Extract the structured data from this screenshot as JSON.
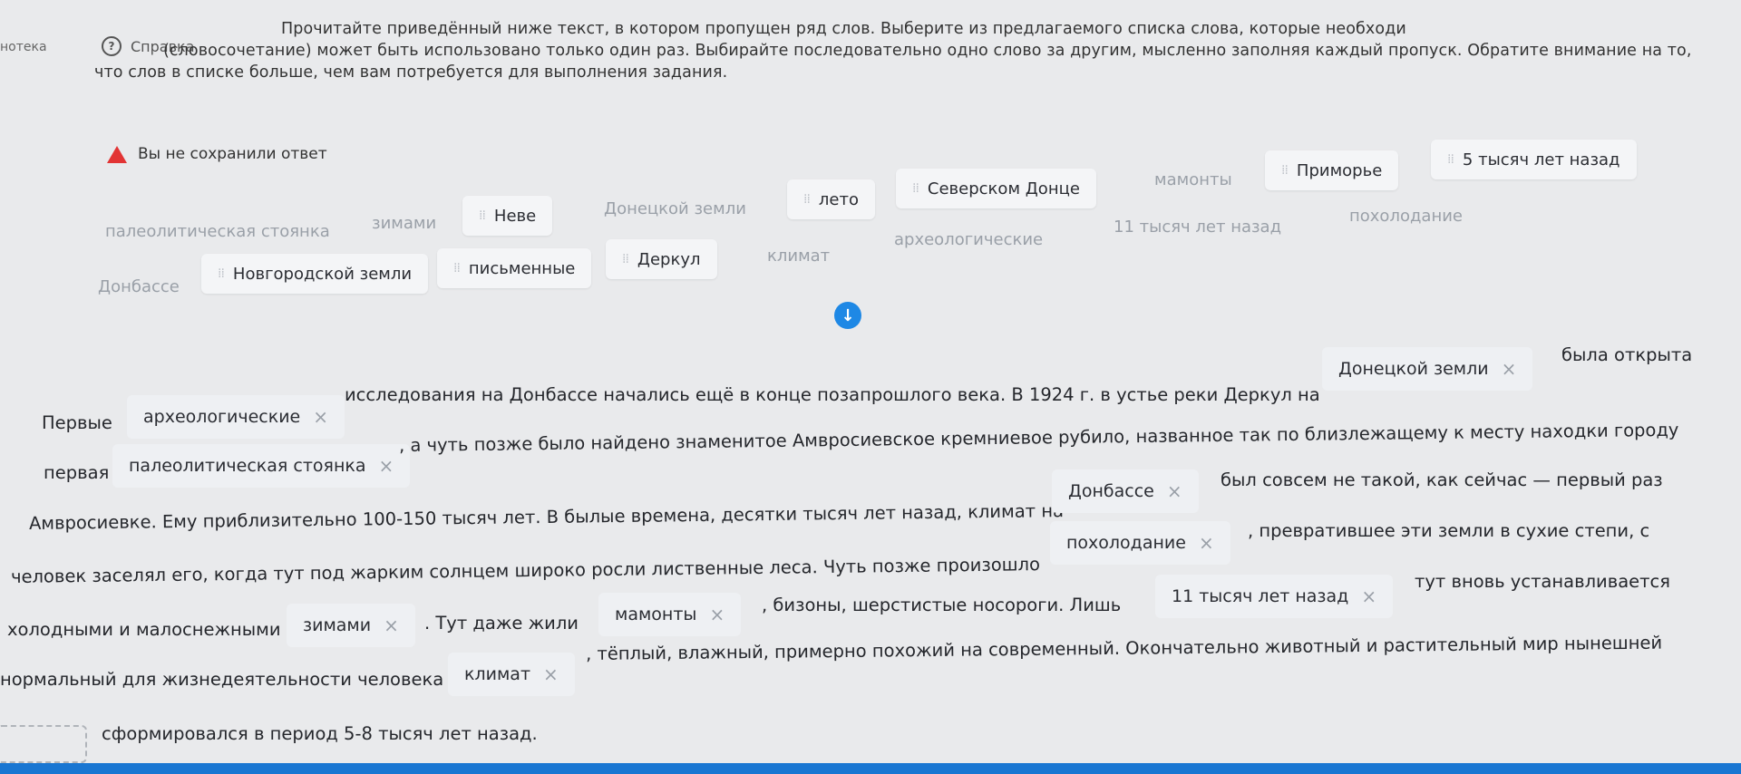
{
  "header": {
    "library_label": "нотека",
    "help_label": "Справка",
    "instruction": "Прочитайте приведённый ниже текст, в котором пропущен ряд слов. Выберите из предлагаемого списка слова, которые необходимо вставить на место пропусков, мысленно заполняя каждый пропуск. Обратите внимание на то, что каждое слово (словосочетание) может быть использовано только один раз. Выбирайте последовательно одно слово за другим, мысленно заполняя каждый пропуск. Обратите внимание на то, что слов в списке больше, чем вам потребуется для выполнения задания.",
    "instruction_lines": [
      "Прочитайте приведённый ниже текст, в котором пропущен ряд слов. Выберите из предлагаемого списка слова, которые необходи",
      "(словосочетание) может быть использовано только один раз. Выбирайте последовательно одно слово за другим, мысленно заполняя каждый пропуск. Обратите внимание на то,",
      "что слов в списке больше, чем вам потребуется для выполнения задания."
    ]
  },
  "warning": {
    "text": "Вы не сохранили ответ"
  },
  "word_bank": [
    {
      "label": "лето",
      "state": "active"
    },
    {
      "label": "Северском Донце",
      "state": "active"
    },
    {
      "label": "мамонты",
      "state": "used"
    },
    {
      "label": "Приморье",
      "state": "active"
    },
    {
      "label": "5 тысяч лет назад",
      "state": "active"
    },
    {
      "label": "палеолитическая стоянка",
      "state": "used"
    },
    {
      "label": "зимами",
      "state": "used"
    },
    {
      "label": "Неве",
      "state": "active"
    },
    {
      "label": "Донецкой земли",
      "state": "used"
    },
    {
      "label": "11 тысяч лет назад",
      "state": "used"
    },
    {
      "label": "похолодание",
      "state": "used"
    },
    {
      "label": "Донбассе",
      "state": "used"
    },
    {
      "label": "Новгородской земли",
      "state": "active"
    },
    {
      "label": "письменные",
      "state": "active"
    },
    {
      "label": "Деркул",
      "state": "active"
    },
    {
      "label": "климат",
      "state": "used"
    },
    {
      "label": "археологические",
      "state": "used"
    }
  ],
  "passage": {
    "segments": [
      "Первые",
      "исследования на Донбассе начались ещё в конце позапрошлого века. В 1924 г. в устье реки Деркул на",
      "была открыта",
      "первая",
      ", а чуть позже было найдено знаменитое Амвросиевское кремниевое рубило, названное так по близлежащему к месту находки городу",
      "Амвросиевке. Ему приблизительно 100-150 тысяч лет. В былые времена, десятки тысяч лет назад, климат на",
      "был совсем не такой, как сейчас — первый раз",
      "человек заселял его, когда тут под жарким солнцем широко росли лиственные леса. Чуть позже произошло",
      ", превратившее эти земли в сухие степи, с",
      "холодными и малоснежными",
      ". Тут даже жили",
      ", бизоны, шерстистые носороги. Лишь",
      "тут вновь устанавливается",
      "нормальный для жизнедеятельности человека",
      ", тёплый, влажный, примерно похожий на современный. Окончательно животный и растительный мир нынешней",
      "сформировался в период 5-8 тысяч лет назад."
    ],
    "filled": [
      "археологические",
      "Донецкой земли",
      "палеолитическая стоянка",
      "Донбассе",
      "похолодание",
      "зимами",
      "мамонты",
      "11 тысяч лет назад",
      "климат"
    ],
    "remove_symbol": "×",
    "grip_symbol": "⁞⁞",
    "scroll_down_symbol": "↓"
  }
}
